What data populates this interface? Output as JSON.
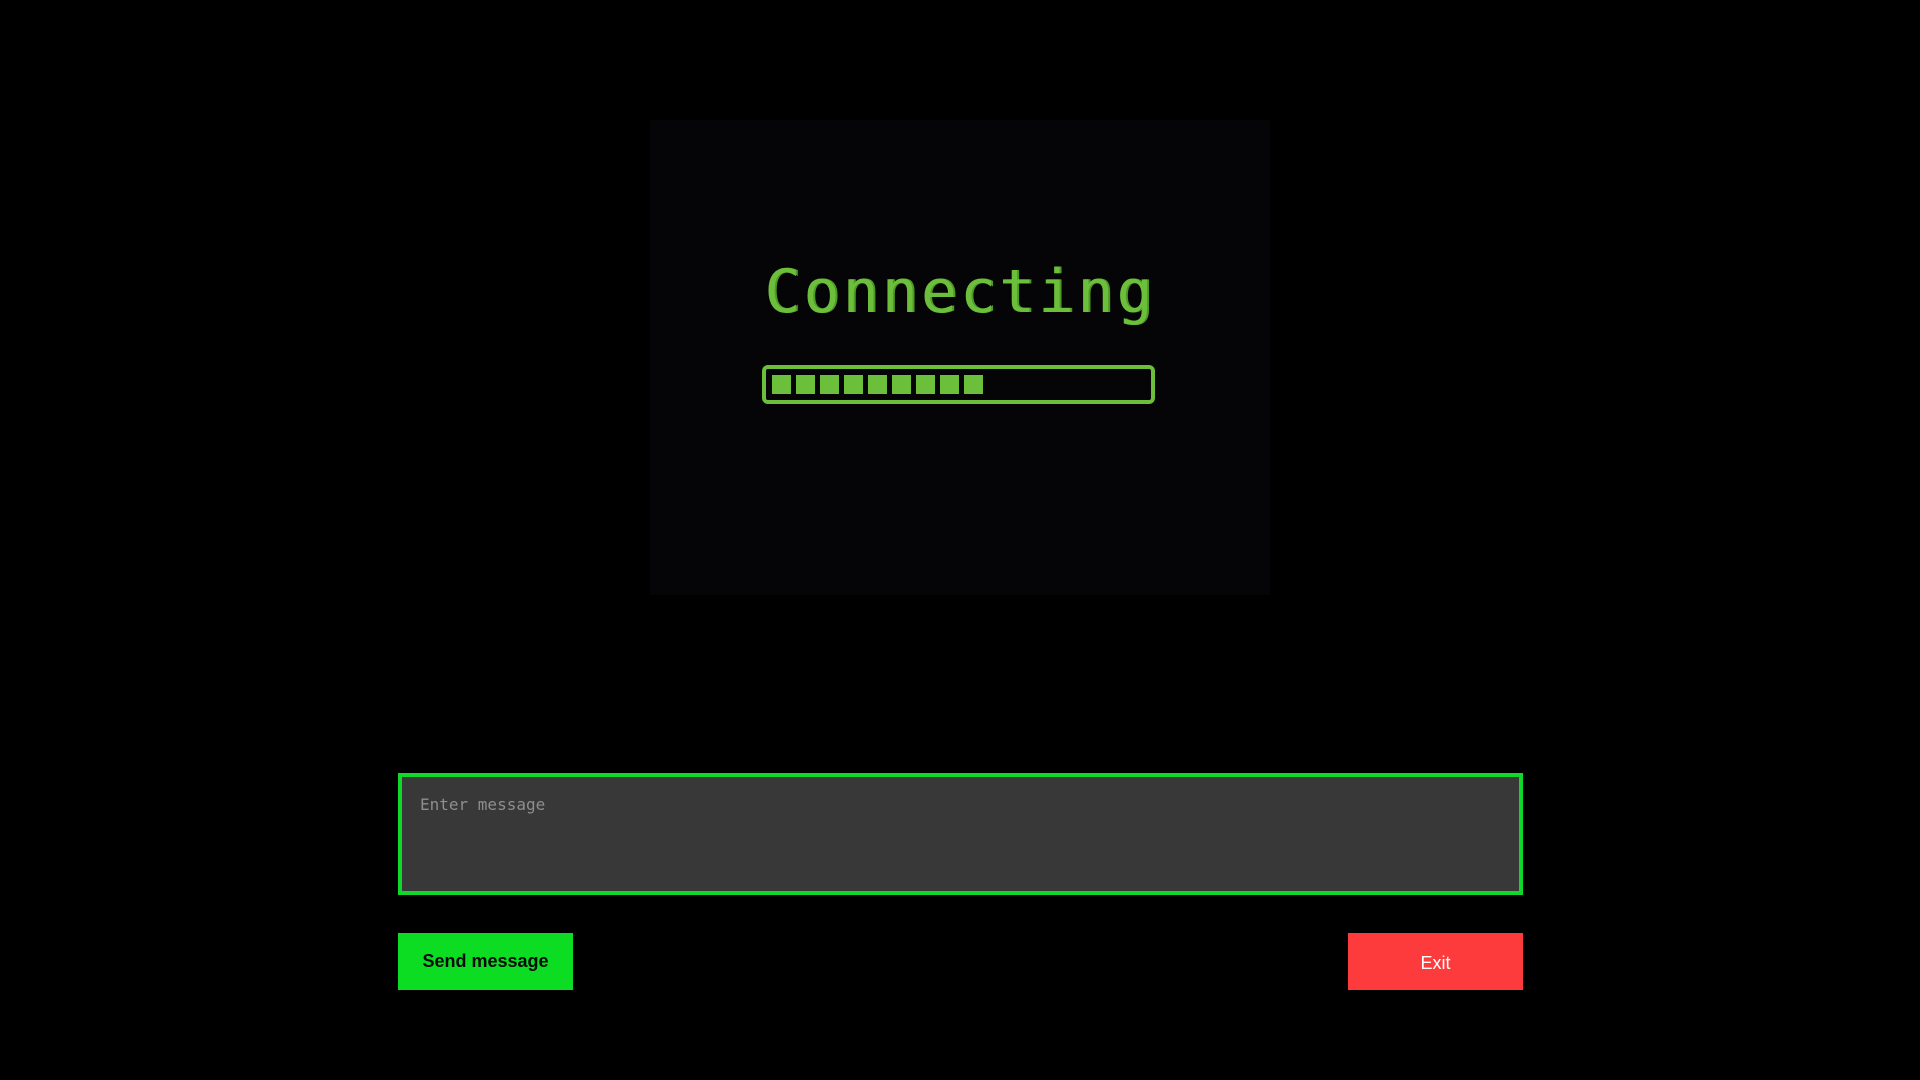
{
  "status": {
    "title": "Connecting",
    "progress": {
      "filled_segments": 9,
      "fraction": 0.53
    },
    "accent_color": "#6cbf3a"
  },
  "message": {
    "placeholder": "Enter message",
    "value": "",
    "border_color": "#0fd82a"
  },
  "actions": {
    "send_label": "Send message",
    "send_color": "#0ddd22",
    "exit_label": "Exit",
    "exit_color": "#fd3b3d"
  }
}
